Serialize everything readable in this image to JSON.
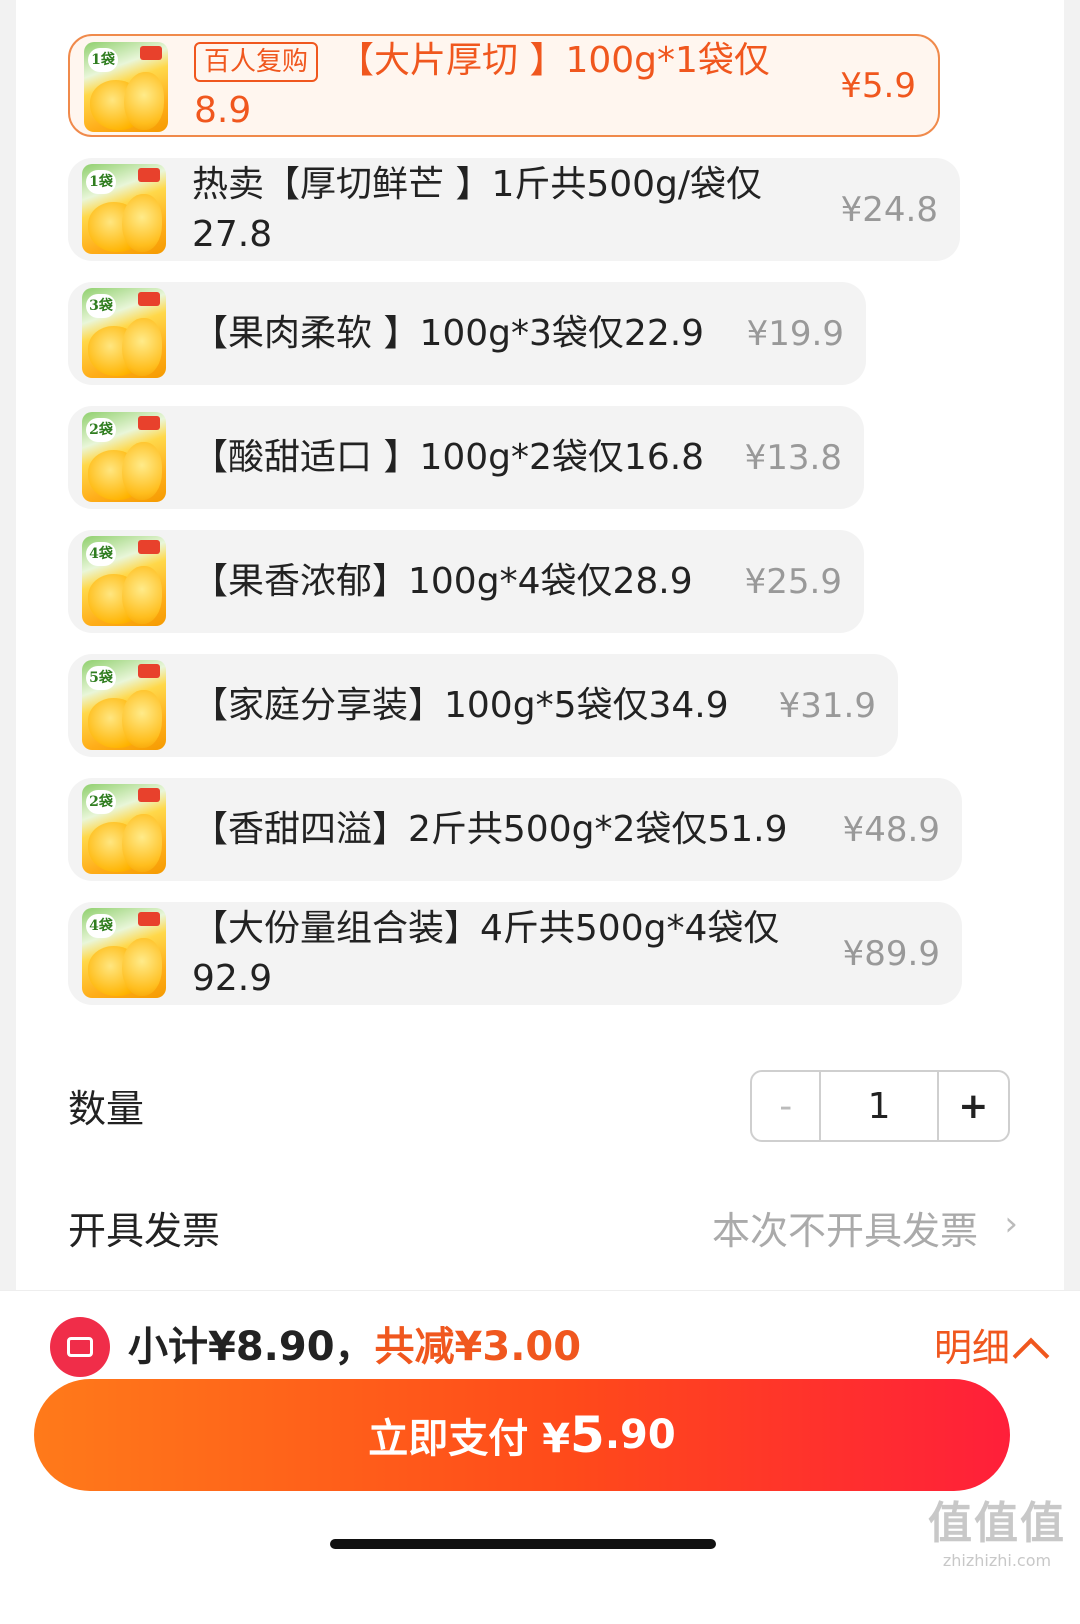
{
  "options": [
    {
      "badge": "百人复购",
      "label": "【大片厚切 】100g*1袋仅8.9",
      "price": "¥5.9",
      "thumb_tag": "1袋"
    },
    {
      "badge": "",
      "label": "热卖【厚切鲜芒 】1斤共500g/袋仅27.8",
      "price": "¥24.8",
      "thumb_tag": "1袋"
    },
    {
      "badge": "",
      "label": "【果肉柔软 】100g*3袋仅22.9",
      "price": "¥19.9",
      "thumb_tag": "3袋"
    },
    {
      "badge": "",
      "label": "【酸甜适口 】100g*2袋仅16.8",
      "price": "¥13.8",
      "thumb_tag": "2袋"
    },
    {
      "badge": "",
      "label": "【果香浓郁】100g*4袋仅28.9",
      "price": "¥25.9",
      "thumb_tag": "4袋"
    },
    {
      "badge": "",
      "label": "【家庭分享装】100g*5袋仅34.9",
      "price": "¥31.9",
      "thumb_tag": "5袋"
    },
    {
      "badge": "",
      "label": "【香甜四溢】2斤共500g*2袋仅51.9",
      "price": "¥48.9",
      "thumb_tag": "2袋"
    },
    {
      "badge": "",
      "label": "【大份量组合装】4斤共500g*4袋仅92.9",
      "price": "¥89.9",
      "thumb_tag": "4袋"
    }
  ],
  "quantity": {
    "label": "数量",
    "minus": "-",
    "value": "1",
    "plus": "+"
  },
  "invoice": {
    "label": "开具发票",
    "value": "本次不开具发票",
    "arrow": "›"
  },
  "summary": {
    "subtotal": "小计¥8.90，",
    "saved": "共减¥3.00",
    "detail": "明细"
  },
  "pay": {
    "label": "立即支付 ¥",
    "amount_int": "5",
    "amount_dec": ".90"
  },
  "watermark": {
    "logo": "值值值",
    "url": "zhizhizhi.com"
  },
  "colors": {
    "accent": "#f0571e",
    "pay_start": "#ff7a1a",
    "pay_end": "#ff1f3a"
  }
}
